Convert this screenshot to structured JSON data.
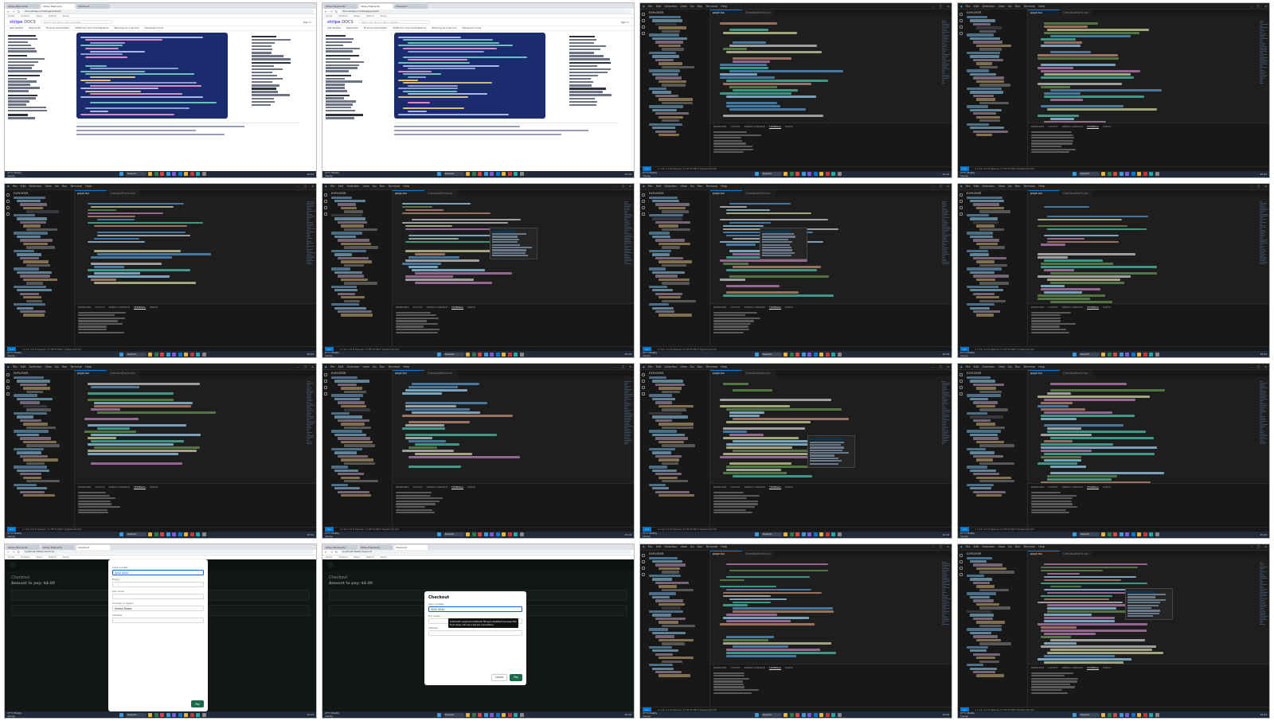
{
  "vscode": {
    "menu": [
      "File",
      "Edit",
      "Selection",
      "View",
      "Go",
      "Run",
      "Terminal",
      "Help"
    ],
    "explorer_title": "EXPLORER",
    "tab_labels": [
      "page.tsx",
      "CheckoutForm.tsx"
    ],
    "panel_tabs": [
      "PROBLEMS",
      "OUTPUT",
      "DEBUG CONSOLE",
      "TERMINAL",
      "PORTS"
    ],
    "status_remote": "><",
    "status_text": "Ln 12, Col 8   Spaces: 2   UTF-8   CRLF   TypeScript JSX"
  },
  "browser": {
    "tabs": [
      "Stripe Payments",
      "Stripe Elements",
      "Checkout"
    ],
    "url_stripe": "docs.stripe.com/stripe-js/react",
    "url_app": "localhost:3000/checkout",
    "bookmarks": [
      "Gmail",
      "YouTube",
      "Maps",
      "GitHub",
      "Stripe"
    ]
  },
  "stripe_docs": {
    "logo": "stripe",
    "logo_suffix": "DOCS",
    "search_placeholder": "Search the docs or ask a question",
    "nav": [
      "Get started",
      "Payments",
      "Finance automation",
      "Platforms and marketplaces",
      "Banking as a service",
      "Developer tools"
    ],
    "signin": "Sign in"
  },
  "checkout_app": {
    "title": "Checkout",
    "amount": "Amount to pay: $4.00",
    "modal_title": "Checkout",
    "card_label": "Card number",
    "card_value": "4242 4242",
    "expiry_label": "Expiry",
    "country_label": "Country or region",
    "country_value": "United States",
    "name_label": "Full name",
    "address_label": "Address",
    "cancel": "Cancel",
    "pay": "Pay",
    "tooltip": "Automatic payment methods filling is disabled because this form does not use a secure connection."
  },
  "taskbar": {
    "weather": "27°C Mostly cloudy",
    "search": "Search",
    "clock": "15:24"
  }
}
